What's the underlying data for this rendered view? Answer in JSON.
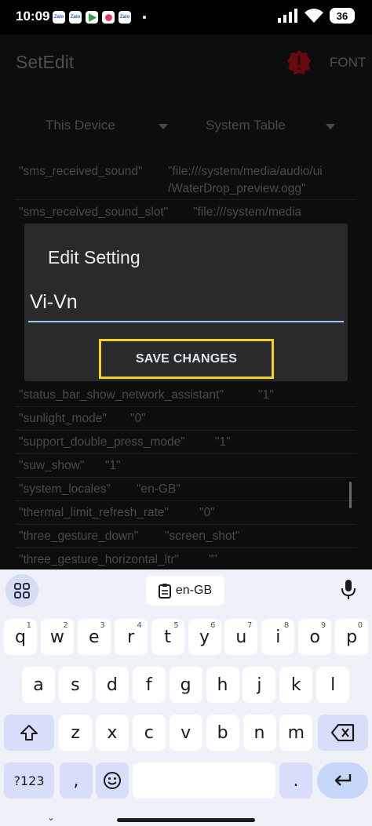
{
  "status_bar": {
    "time": "10:09",
    "notif_icons": [
      "Zalo",
      "Zalo",
      "play-store",
      "app",
      "Zalo"
    ],
    "battery": "36"
  },
  "app": {
    "title": "SetEdit",
    "font_label": "FONT",
    "device_spinner": "This Device",
    "table_spinner": "System Table",
    "rows": [
      {
        "key": "\"sms_received_sound\"",
        "value": "\"file:///system/media/audio/ui",
        "value2": "/WaterDrop_preview.ogg\""
      },
      {
        "key": "\"sms_received_sound_slot\"",
        "value": "\"file:///system/media"
      },
      {
        "key": "\"status_bar_show_network_assistant\"",
        "value": "\"1\""
      },
      {
        "key": "\"sunlight_mode\"",
        "value": "\"0\""
      },
      {
        "key": "\"support_double_press_mode\"",
        "value": "\"1\""
      },
      {
        "key": "\"suw_show\"",
        "value": "\"1\""
      },
      {
        "key": "\"system_locales\"",
        "value": "\"en-GB\""
      },
      {
        "key": "\"thermal_limit_refresh_rate\"",
        "value": "\"0\""
      },
      {
        "key": "\"three_gesture_down\"",
        "value": "\"screen_shot\""
      },
      {
        "key": "\"three_gesture_horizontal_ltr\"",
        "value": "\"\""
      }
    ]
  },
  "dialog": {
    "title": "Edit Setting",
    "input_value": "Vi-Vn",
    "save_label": "SAVE CHANGES"
  },
  "keyboard": {
    "clipboard_chip": "en-GB",
    "row1": [
      {
        "k": "q",
        "h": "1"
      },
      {
        "k": "w",
        "h": "2"
      },
      {
        "k": "e",
        "h": "3"
      },
      {
        "k": "r",
        "h": "4"
      },
      {
        "k": "t",
        "h": "5"
      },
      {
        "k": "y",
        "h": "6"
      },
      {
        "k": "u",
        "h": "7"
      },
      {
        "k": "i",
        "h": "8"
      },
      {
        "k": "o",
        "h": "9"
      },
      {
        "k": "p",
        "h": "0"
      }
    ],
    "row2": [
      "a",
      "s",
      "d",
      "f",
      "g",
      "h",
      "j",
      "k",
      "l"
    ],
    "row3": [
      "z",
      "x",
      "c",
      "v",
      "b",
      "n",
      "m"
    ],
    "symbols_key": "?123",
    "comma_key": ",",
    "period_key": "."
  },
  "colors": {
    "accent_border": "#f5cf2a",
    "input_underline": "#9ecaf2",
    "alert_red": "#c0141c"
  }
}
